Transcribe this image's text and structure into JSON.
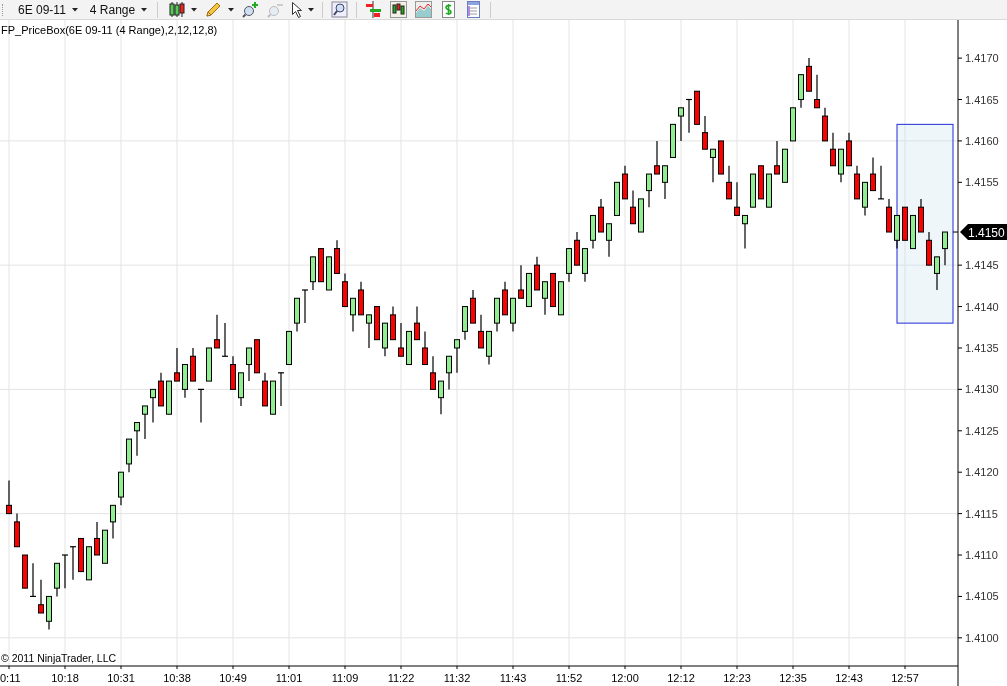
{
  "toolbar": {
    "instrument": {
      "label": "6E 09-11"
    },
    "interval": {
      "label": "4 Range"
    },
    "tools": [
      {
        "kind": "candles",
        "dropdown": true,
        "disabled": false
      },
      {
        "kind": "pencil",
        "dropdown": true,
        "disabled": false
      },
      {
        "kind": "zoom-add",
        "dropdown": false,
        "disabled": false
      },
      {
        "kind": "zoom-remove",
        "dropdown": false,
        "disabled": true
      },
      {
        "kind": "pointer",
        "dropdown": true,
        "disabled": false
      },
      {
        "kind": "zoom",
        "dropdown": false,
        "disabled": false
      },
      {
        "kind": "bars",
        "dropdown": false,
        "disabled": false
      },
      {
        "kind": "candle-box",
        "dropdown": false,
        "disabled": false
      },
      {
        "kind": "area",
        "dropdown": false,
        "disabled": false
      },
      {
        "kind": "dollar",
        "dropdown": false,
        "disabled": false
      },
      {
        "kind": "document",
        "dropdown": false,
        "disabled": false
      }
    ]
  },
  "chart": {
    "title": "FP_PriceBox(6E 09-11 (4 Range),2,12,12,8)",
    "copyright": "© 2011 NinjaTrader, LLC",
    "last_price": "1.4150",
    "chart_data": {
      "type": "candlestick",
      "categories": [
        "0:11",
        null,
        null,
        null,
        null,
        null,
        null,
        "10:18",
        null,
        null,
        null,
        null,
        null,
        null,
        "10:31",
        null,
        null,
        null,
        null,
        null,
        null,
        "10:38",
        null,
        null,
        null,
        null,
        null,
        null,
        "10:49",
        null,
        null,
        null,
        null,
        null,
        null,
        "11:01",
        null,
        null,
        null,
        null,
        null,
        null,
        "11:09",
        null,
        null,
        null,
        null,
        null,
        null,
        "11:22",
        null,
        null,
        null,
        null,
        null,
        null,
        "11:32",
        null,
        null,
        null,
        null,
        null,
        null,
        "11:43",
        null,
        null,
        null,
        null,
        null,
        null,
        "11:52",
        null,
        null,
        null,
        null,
        null,
        null,
        "12:00",
        null,
        null,
        null,
        null,
        null,
        null,
        "12:12",
        null,
        null,
        null,
        null,
        null,
        null,
        "12:23",
        null,
        null,
        null,
        null,
        null,
        null,
        "12:35",
        null,
        null,
        null,
        null,
        null,
        null,
        "12:43",
        null,
        null,
        null,
        null,
        null,
        null,
        "12:57",
        null,
        null,
        null,
        null,
        null
      ],
      "ylim": [
        1.40966,
        1.41746
      ],
      "grid": true,
      "yticks": [
        {
          "value": 1.417,
          "label": "1.4170"
        },
        {
          "value": 1.4165,
          "label": "1.4165"
        },
        {
          "value": 1.416,
          "label": "1.4160"
        },
        {
          "value": 1.4155,
          "label": "1.4155"
        },
        {
          "value": 1.4145,
          "label": "1.4145"
        },
        {
          "value": 1.414,
          "label": "1.4140"
        },
        {
          "value": 1.4135,
          "label": "1.4135"
        },
        {
          "value": 1.413,
          "label": "1.4130"
        },
        {
          "value": 1.4125,
          "label": "1.4125"
        },
        {
          "value": 1.412,
          "label": "1.4120"
        },
        {
          "value": 1.4115,
          "label": "1.4115"
        },
        {
          "value": 1.411,
          "label": "1.4110"
        },
        {
          "value": 1.4105,
          "label": "1.4105"
        },
        {
          "value": 1.41,
          "label": "1.4100"
        }
      ],
      "ohlc": [
        [
          1.4116,
          1.4119,
          1.4115,
          1.4115
        ],
        [
          1.4114,
          1.4115,
          1.4111,
          1.4111
        ],
        [
          1.411,
          1.411,
          1.4106,
          1.4106
        ],
        [
          1.4105,
          1.4109,
          1.4105,
          1.4105
        ],
        [
          1.4104,
          1.4107,
          1.4103,
          1.4103
        ],
        [
          1.4102,
          1.4105,
          1.4101,
          1.4105
        ],
        [
          1.4106,
          1.4109,
          1.4105,
          1.4109
        ],
        [
          1.411,
          1.411,
          1.4106,
          1.411
        ],
        [
          1.4111,
          1.4111,
          1.4107,
          1.4111
        ],
        [
          1.4112,
          1.4112,
          1.4108,
          1.4108
        ],
        [
          1.4107,
          1.4111,
          1.4107,
          1.4111
        ],
        [
          1.4112,
          1.4114,
          1.411,
          1.411
        ],
        [
          1.4109,
          1.4113,
          1.4109,
          1.4113
        ],
        [
          1.4114,
          1.4116,
          1.4112,
          1.4116
        ],
        [
          1.4117,
          1.412,
          1.4116,
          1.412
        ],
        [
          1.4121,
          1.4124,
          1.412,
          1.4124
        ],
        [
          1.4125,
          1.4126,
          1.4122,
          1.4126
        ],
        [
          1.4127,
          1.4128,
          1.4124,
          1.4128
        ],
        [
          1.4129,
          1.413,
          1.4126,
          1.413
        ],
        [
          1.4131,
          1.4132,
          1.4128,
          1.4128
        ],
        [
          1.4127,
          1.4131,
          1.4127,
          1.4131
        ],
        [
          1.4132,
          1.4135,
          1.4131,
          1.4131
        ],
        [
          1.413,
          1.4133,
          1.4129,
          1.4133
        ],
        [
          1.4134,
          1.4135,
          1.4131,
          1.4131
        ],
        [
          1.413,
          1.413,
          1.4126,
          1.413
        ],
        [
          1.4131,
          1.4135,
          1.4131,
          1.4135
        ],
        [
          1.4136,
          1.4139,
          1.4135,
          1.4135
        ],
        [
          1.4134,
          1.4138,
          1.4134,
          1.4134
        ],
        [
          1.4133,
          1.4134,
          1.413,
          1.413
        ],
        [
          1.4129,
          1.4132,
          1.4128,
          1.4132
        ],
        [
          1.4133,
          1.4135,
          1.4131,
          1.4135
        ],
        [
          1.4136,
          1.4136,
          1.4132,
          1.4132
        ],
        [
          1.4131,
          1.4132,
          1.4128,
          1.4128
        ],
        [
          1.4127,
          1.4131,
          1.4127,
          1.4131
        ],
        [
          1.4132,
          1.4132,
          1.4128,
          1.4132
        ],
        [
          1.4133,
          1.4137,
          1.4133,
          1.4137
        ],
        [
          1.4138,
          1.4141,
          1.4137,
          1.4141
        ],
        [
          1.4142,
          1.4142,
          1.4138,
          1.4142
        ],
        [
          1.4143,
          1.4146,
          1.4142,
          1.4146
        ],
        [
          1.4147,
          1.4147,
          1.4143,
          1.4143
        ],
        [
          1.4142,
          1.4146,
          1.4142,
          1.4146
        ],
        [
          1.4147,
          1.4148,
          1.4144,
          1.4144
        ],
        [
          1.4143,
          1.4144,
          1.414,
          1.414
        ],
        [
          1.4139,
          1.4141,
          1.4137,
          1.4141
        ],
        [
          1.4142,
          1.4143,
          1.4139,
          1.4139
        ],
        [
          1.4138,
          1.4139,
          1.4135,
          1.4139
        ],
        [
          1.414,
          1.414,
          1.4136,
          1.4136
        ],
        [
          1.4135,
          1.4138,
          1.4134,
          1.4138
        ],
        [
          1.4139,
          1.414,
          1.4136,
          1.4136
        ],
        [
          1.4135,
          1.4138,
          1.4134,
          1.4134
        ],
        [
          1.4133,
          1.4137,
          1.4133,
          1.4137
        ],
        [
          1.4138,
          1.414,
          1.4136,
          1.4136
        ],
        [
          1.4135,
          1.4137,
          1.4133,
          1.4133
        ],
        [
          1.4132,
          1.4134,
          1.413,
          1.413
        ],
        [
          1.4129,
          1.4131,
          1.4127,
          1.4131
        ],
        [
          1.4132,
          1.4134,
          1.413,
          1.4134
        ],
        [
          1.4135,
          1.4136,
          1.4132,
          1.4136
        ],
        [
          1.4137,
          1.414,
          1.4136,
          1.414
        ],
        [
          1.4141,
          1.4142,
          1.4138,
          1.4138
        ],
        [
          1.4137,
          1.4139,
          1.4135,
          1.4135
        ],
        [
          1.4134,
          1.4137,
          1.4133,
          1.4137
        ],
        [
          1.4138,
          1.4141,
          1.4137,
          1.4141
        ],
        [
          1.4142,
          1.4143,
          1.4139,
          1.4139
        ],
        [
          1.4138,
          1.4141,
          1.4137,
          1.4141
        ],
        [
          1.4142,
          1.4145,
          1.4141,
          1.4141
        ],
        [
          1.414,
          1.4144,
          1.414,
          1.4144
        ],
        [
          1.4145,
          1.4146,
          1.4142,
          1.4142
        ],
        [
          1.4141,
          1.4143,
          1.4139,
          1.4143
        ],
        [
          1.4144,
          1.4144,
          1.414,
          1.414
        ],
        [
          1.4139,
          1.4143,
          1.4139,
          1.4143
        ],
        [
          1.4144,
          1.4147,
          1.4143,
          1.4147
        ],
        [
          1.4148,
          1.4149,
          1.4145,
          1.4145
        ],
        [
          1.4144,
          1.4147,
          1.4143,
          1.4147
        ],
        [
          1.4148,
          1.4151,
          1.4147,
          1.4151
        ],
        [
          1.4152,
          1.4153,
          1.4149,
          1.4149
        ],
        [
          1.4148,
          1.415,
          1.4146,
          1.415
        ],
        [
          1.4151,
          1.4155,
          1.4151,
          1.4155
        ],
        [
          1.4156,
          1.4157,
          1.4153,
          1.4153
        ],
        [
          1.4152,
          1.4154,
          1.415,
          1.415
        ],
        [
          1.4149,
          1.4153,
          1.4149,
          1.4153
        ],
        [
          1.4154,
          1.4156,
          1.4152,
          1.4156
        ],
        [
          1.4157,
          1.416,
          1.4156,
          1.4156
        ],
        [
          1.4155,
          1.4157,
          1.4153,
          1.4157
        ],
        [
          1.4158,
          1.4162,
          1.4158,
          1.4162
        ],
        [
          1.4163,
          1.4164,
          1.416,
          1.4164
        ],
        [
          1.4165,
          1.4165,
          1.4161,
          1.4165
        ],
        [
          1.4166,
          1.4166,
          1.4162,
          1.4162
        ],
        [
          1.4161,
          1.4163,
          1.4159,
          1.4159
        ],
        [
          1.4158,
          1.4159,
          1.4155,
          1.4159
        ],
        [
          1.416,
          1.416,
          1.4156,
          1.4156
        ],
        [
          1.4155,
          1.4157,
          1.4153,
          1.4153
        ],
        [
          1.4152,
          1.4155,
          1.4151,
          1.4151
        ],
        [
          1.415,
          1.4151,
          1.4147,
          1.4151
        ],
        [
          1.4152,
          1.4156,
          1.4152,
          1.4156
        ],
        [
          1.4157,
          1.4157,
          1.4153,
          1.4153
        ],
        [
          1.4152,
          1.4156,
          1.4152,
          1.4156
        ],
        [
          1.4157,
          1.416,
          1.4156,
          1.4156
        ],
        [
          1.4155,
          1.4159,
          1.4155,
          1.4159
        ],
        [
          1.416,
          1.4164,
          1.416,
          1.4164
        ],
        [
          1.4165,
          1.4168,
          1.4164,
          1.4168
        ],
        [
          1.4169,
          1.417,
          1.4166,
          1.4166
        ],
        [
          1.4165,
          1.4168,
          1.4164,
          1.4164
        ],
        [
          1.4163,
          1.4164,
          1.416,
          1.416
        ],
        [
          1.4159,
          1.4161,
          1.4157,
          1.4157
        ],
        [
          1.4156,
          1.4159,
          1.4155,
          1.4159
        ],
        [
          1.416,
          1.4161,
          1.4157,
          1.4157
        ],
        [
          1.4156,
          1.4157,
          1.4153,
          1.4153
        ],
        [
          1.4152,
          1.4155,
          1.4151,
          1.4155
        ],
        [
          1.4156,
          1.4158,
          1.4154,
          1.4154
        ],
        [
          1.4153,
          1.4157,
          1.4153,
          1.4153
        ],
        [
          1.4152,
          1.4153,
          1.4149,
          1.4149
        ],
        [
          1.4148,
          1.4151,
          1.4147,
          1.4151
        ],
        [
          1.4152,
          1.4152,
          1.4148,
          1.4148
        ],
        [
          1.4147,
          1.4151,
          1.4147,
          1.4151
        ],
        [
          1.4152,
          1.4153,
          1.4149,
          1.4149
        ],
        [
          1.4148,
          1.4149,
          1.4145,
          1.4145
        ],
        [
          1.4144,
          1.4146,
          1.4142,
          1.4146
        ],
        [
          1.4147,
          1.4149,
          1.4145,
          1.4149
        ]
      ]
    }
  }
}
